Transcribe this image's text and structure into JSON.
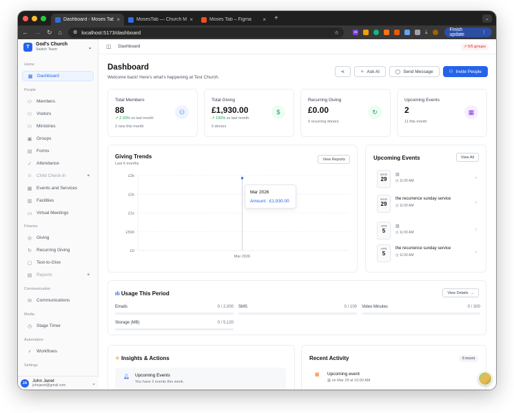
{
  "browser": {
    "tabs": [
      {
        "title": "Dashboard - Moses Tab",
        "fav": "#2f6fe4",
        "active": true
      },
      {
        "title": "MosesTab — Church Managem",
        "fav": "#2f6fe4",
        "active": false
      },
      {
        "title": "Moses Tab – Figma",
        "fav": "#f24e1e",
        "active": false
      }
    ],
    "url": "localhost:5173/dashboard",
    "ext_badge": "26",
    "finish_update": "Finish update"
  },
  "sidebar": {
    "team_name": "God's Church",
    "team_sub": "Switch Team",
    "team_initial": "T",
    "sections": {
      "home": "Home",
      "people": "People",
      "finance": "Finance",
      "communication": "Communication",
      "media": "Media",
      "automation": "Automation",
      "settings": "Settings"
    },
    "items": {
      "dashboard": "Dashboard",
      "members": "Members",
      "visitors": "Visitors",
      "ministries": "Ministries",
      "groups": "Groups",
      "forms": "Forms",
      "attendance": "Attendance",
      "child_checkin": "Child Check-In",
      "events": "Events and Services",
      "facilities": "Facilities",
      "virtual": "Virtual Meetings",
      "giving": "Giving",
      "recurring": "Recurring Giving",
      "text_to_give": "Text-to-Give",
      "reports": "Reports",
      "communications": "Communications",
      "stage_timer": "Stage Timer",
      "workflows": "Workflows"
    },
    "user": {
      "initials": "JA",
      "name": "John Janet",
      "email": "johnjanet@gmail.com"
    }
  },
  "header": {
    "breadcrumb": "Dashboard",
    "groups_pill": "5/5 groups"
  },
  "page": {
    "title": "Dashboard",
    "welcome": "Welcome back! Here's what's happening at Test Church.",
    "buttons": {
      "ask_ai": "Ask AI",
      "send_message": "Send Message",
      "invite_people": "Invite People"
    }
  },
  "stats": [
    {
      "label": "Total Members",
      "value": "88",
      "change": "2.33%",
      "change_suffix": "vs last month",
      "sub": "2 new this month",
      "icon": "users-icon",
      "color": "#2563eb",
      "bg": "#eef4ff"
    },
    {
      "label": "Total Giving",
      "value": "£1,930.00",
      "change": "100%",
      "change_suffix": "vs last month",
      "sub": "0 donors",
      "icon": "dollar-icon",
      "color": "#16a34a",
      "bg": "#ecfdf3"
    },
    {
      "label": "Recurring Giving",
      "value": "£0.00",
      "change": "",
      "change_suffix": "",
      "sub": "0 recurring donors",
      "icon": "refresh-icon",
      "color": "#16a34a",
      "bg": "#ecfdf3"
    },
    {
      "label": "Upcoming Events",
      "value": "2",
      "change": "",
      "change_suffix": "",
      "sub": "11 this month",
      "icon": "calendar-icon",
      "color": "#9333ea",
      "bg": "#f5efff"
    }
  ],
  "giving_trends": {
    "title": "Giving Trends",
    "subtitle": "Last 6 months",
    "view_reports": "View Reports",
    "tooltip_date": "Mar 2026",
    "tooltip_value": "Amount : £1,930.00"
  },
  "chart_data": {
    "type": "line",
    "categories": [
      "Mar 2026"
    ],
    "series": [
      {
        "values": [
          1930
        ]
      }
    ],
    "ylim": [
      0,
      2000
    ],
    "yticks": [
      "£0",
      "£500",
      "£1k",
      "£2k",
      "£2k"
    ],
    "grid": true
  },
  "upcoming": {
    "title": "Upcoming Events",
    "view_all": "View All",
    "events": [
      {
        "month": "MAR",
        "day": "29",
        "title": "",
        "time": "11:00 AM"
      },
      {
        "month": "MAR",
        "day": "29",
        "title": "the recurrence sunday service",
        "time": "11:00 AM"
      },
      {
        "month": "APR",
        "day": "5",
        "title": "",
        "time": "11:00 AM"
      },
      {
        "month": "APR",
        "day": "5",
        "title": "the recurrence sunday service",
        "time": "11:00 AM"
      }
    ]
  },
  "usage": {
    "title": "Usage This Period",
    "view_details": "View Details",
    "items": [
      {
        "label": "Emails",
        "value": "0 / 2,000"
      },
      {
        "label": "SMS",
        "value": "0 / 100"
      },
      {
        "label": "Video Minutes",
        "value": "0 / 300"
      },
      {
        "label": "Storage (MB)",
        "value": "0 / 5,120"
      }
    ]
  },
  "insights": {
    "title": "Insights & Actions",
    "item_title": "Upcoming Events",
    "item_text": "You have 2 events this week."
  },
  "activity": {
    "title": "Recent Activity",
    "count": "9 recent",
    "item_title": "Upcoming event",
    "item_text": "on Mar 29 at 10:00 AM"
  }
}
